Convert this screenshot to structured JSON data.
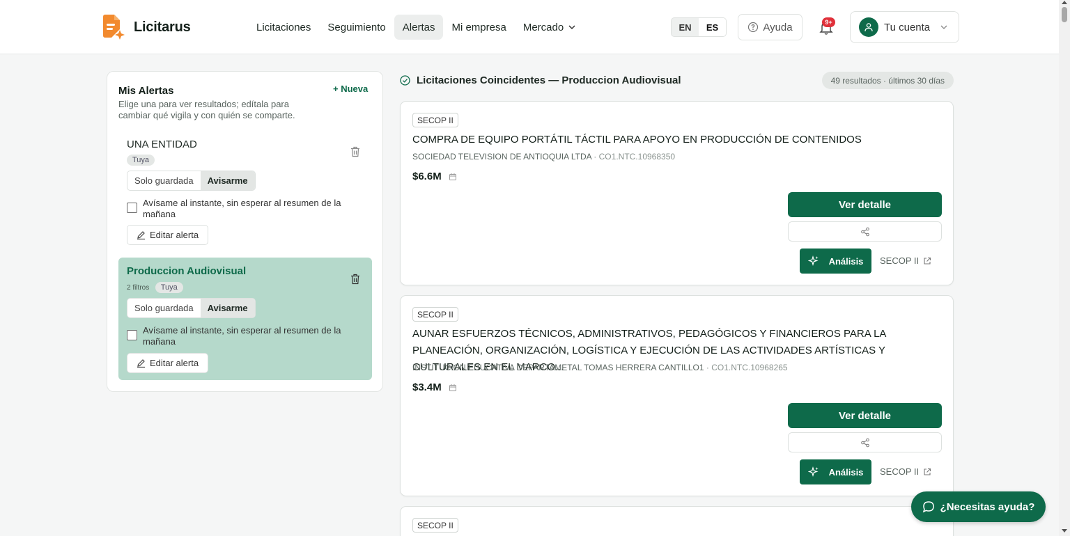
{
  "brand": {
    "name": "Licitarus"
  },
  "nav": [
    {
      "label": "Licitaciones",
      "active": false
    },
    {
      "label": "Seguimiento",
      "active": false
    },
    {
      "label": "Alertas",
      "active": true
    },
    {
      "label": "Mi empresa",
      "active": false
    },
    {
      "label": "Mercado",
      "active": false,
      "dropdown": true
    }
  ],
  "lang": {
    "en": "EN",
    "es": "ES",
    "selected": "ES"
  },
  "help": {
    "label": "Ayuda"
  },
  "notifications": {
    "badge": "9+"
  },
  "account": {
    "label": "Tu cuenta"
  },
  "sidebar": {
    "title": "Mis Alertas",
    "new_label": "+ Nueva",
    "description": "Elige una para ver resultados; edítala para cambiar qué vigila y con quién se comparte.",
    "alerts": [
      {
        "name": "UNA ENTIDAD",
        "filters": "",
        "owner": "Tuya",
        "mode_saved": "Solo guardada",
        "mode_notify": "Avisarme",
        "mode_selected": "Avisarme",
        "instant_label": "Avísame al instante, sin esperar al resumen de la mañana",
        "instant_checked": false,
        "edit_label": "Editar alerta",
        "selected": false
      },
      {
        "name": "Produccion Audiovisual",
        "filters": "2 filtros",
        "owner": "Tuya",
        "mode_saved": "Solo guardada",
        "mode_notify": "Avisarme",
        "mode_selected": "Avisarme",
        "instant_label": "Avísame al instante, sin esperar al resumen de la mañana",
        "instant_checked": false,
        "edit_label": "Editar alerta",
        "selected": true
      }
    ]
  },
  "results": {
    "title": "Licitaciones Coincidentes — Produccion Audiovisual",
    "count": "49 resultados · últimos 30 días",
    "items": [
      {
        "source": "SECOP II",
        "title": "COMPRA DE EQUIPO PORTÁTIL TÁCTIL PARA APOYO EN PRODUCCIÓN DE CONTENIDOS",
        "entity": "SOCIEDAD TELEVISION DE ANTIOQUIA LTDA",
        "code": "CO1.NTC.10968350",
        "price": "$6.6M",
        "detail_label": "Ver detalle",
        "ai_label": "Análisis",
        "source_link": "SECOP II"
      },
      {
        "source": "SECOP II",
        "title": "AUNAR ESFUERZOS TÉCNICOS, ADMINISTRATIVOS, PEDAGÓGICOS Y FINANCIEROS PARA LA PLANEACIÓN, ORGANIZACIÓN, LOGÍSTICA Y EJECUCIÓN DE LAS ACTIVIDADES ARTÍSTICAS Y CULTURALES EN EL MARCO...",
        "entity": "INSTITUCION EDUCATIVA DEPARTAMETAL TOMAS HERRERA CANTILLO1",
        "code": "CO1.NTC.10968265",
        "price": "$3.4M",
        "detail_label": "Ver detalle",
        "ai_label": "Análisis",
        "source_link": "SECOP II"
      },
      {
        "source": "SECOP II"
      }
    ]
  },
  "chat": {
    "label": "¿Necesitas ayuda?"
  },
  "colors": {
    "primary": "#0e6a4a",
    "selected_alert": "#b5d9cb",
    "badge": "#e0303a"
  }
}
